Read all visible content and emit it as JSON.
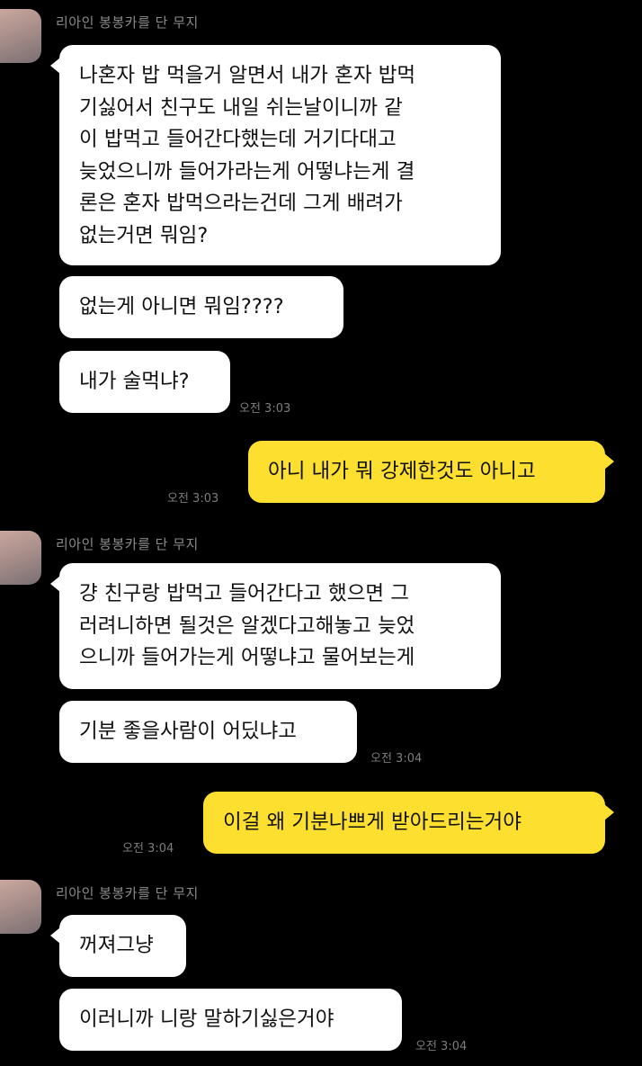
{
  "groups": [
    {
      "sender": "리아인 봉봉카를 단 무지",
      "messages": [
        {
          "lines": [
            "나혼자 밥 먹을거 알면서 내가 혼자 밥먹",
            "기싫어서 친구도 내일 쉬는날이니까 같",
            "이 밥먹고 들어간다했는데 거기다대고",
            "늦었으니까 들어가라는게 어떻냐는게 결",
            "론은 혼자 밥먹으라는건데 그게 배려가",
            "없는거면 뭐임?"
          ]
        },
        {
          "lines": [
            "없는게 아니면 뭐임????"
          ]
        },
        {
          "lines": [
            "내가 술먹냐?"
          ],
          "time": "오전 3:03"
        }
      ]
    },
    {
      "outgoing": true,
      "messages": [
        {
          "lines": [
            "아니 내가 뭐 강제한것도 아니고"
          ],
          "time": "오전 3:03"
        }
      ]
    },
    {
      "sender": "리아인 봉봉카를 단 무지",
      "messages": [
        {
          "lines": [
            "걍 친구랑 밥먹고 들어간다고 했으면 그",
            "러려니하면 될것은 알겠다고해놓고 늦었",
            "으니까 들어가는게 어떻냐고 물어보는게"
          ]
        },
        {
          "lines": [
            "기분 좋을사람이 어딨냐고"
          ],
          "time": "오전 3:04"
        }
      ]
    },
    {
      "outgoing": true,
      "messages": [
        {
          "lines": [
            "이걸 왜 기분나쁘게 받아드리는거야"
          ],
          "time": "오전 3:04"
        }
      ]
    },
    {
      "sender": "리아인 봉봉카를 단 무지",
      "messages": [
        {
          "lines": [
            "꺼져그냥"
          ]
        },
        {
          "lines": [
            "이러니까 니랑 말하기싫은거야"
          ],
          "time": "오전 3:04"
        }
      ]
    }
  ],
  "colors": {
    "background": "#000000",
    "incoming_bubble": "#ffffff",
    "outgoing_bubble": "#fde02f",
    "sender_text": "#8a8a8a",
    "time_text": "#7d7d7d"
  }
}
